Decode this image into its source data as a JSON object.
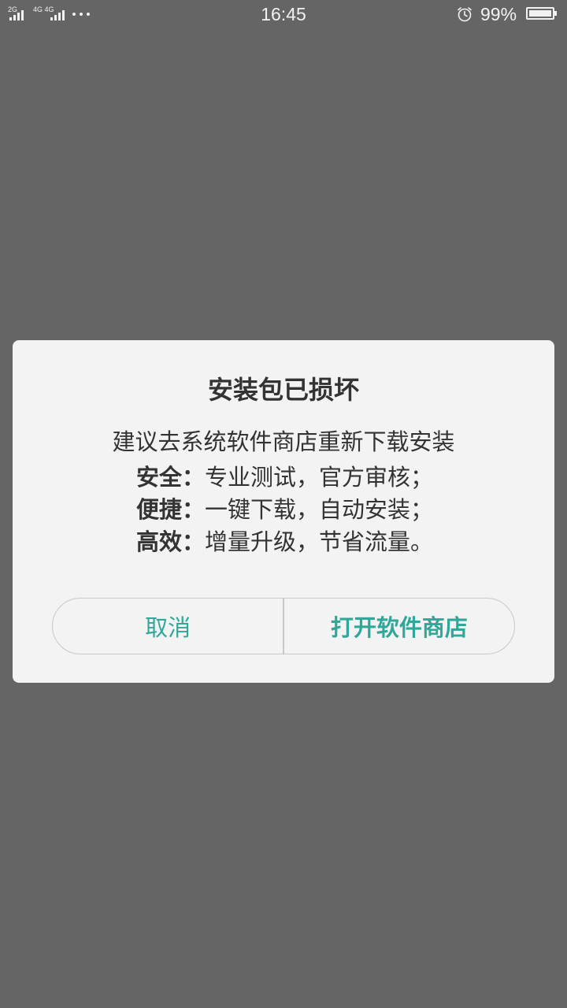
{
  "status_bar": {
    "sim1_label": "2G",
    "sim2_label": "4G 4G",
    "time": "16:45",
    "battery_percent": "99%",
    "icons": [
      "signal-icon",
      "more-dots-icon",
      "alarm-icon",
      "battery-icon"
    ],
    "battery_level": 0.99
  },
  "dialog": {
    "title": "安装包已损坏",
    "intro": "建议去系统软件商店重新下载安装",
    "features": [
      {
        "label": "安全：",
        "text": "专业测试，官方审核；"
      },
      {
        "label": "便捷：",
        "text": "一键下载，自动安装；"
      },
      {
        "label": "高效：",
        "text": "增量升级，节省流量。"
      }
    ],
    "cancel_label": "取消",
    "open_store_label": "打开软件商店"
  },
  "colors": {
    "backdrop": "#656565",
    "dialog_bg": "#f3f3f3",
    "accent": "#2fa89a",
    "text": "#333333"
  }
}
